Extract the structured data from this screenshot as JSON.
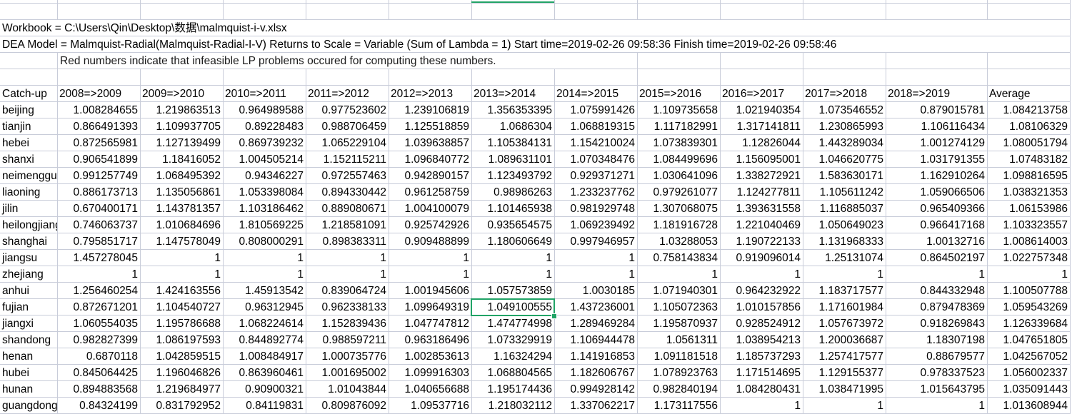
{
  "info": {
    "workbook": "Workbook = C:\\Users\\Qin\\Desktop\\数据\\malmquist-i-v.xlsx",
    "model": "DEA Model = Malmquist-Radial(Malmquist-Radial-I-V)  Returns to Scale = Variable (Sum of Lambda = 1)  Start time=2019-02-26  09:58:36   Finish time=2019-02-26  09:58:46",
    "note": "Red numbers indicate that infeasible LP problems occured for computing these numbers."
  },
  "table": {
    "headers": [
      "Catch-up",
      "2008=>2009",
      "2009=>2010",
      "2010=>2011",
      "2011=>2012",
      "2012=>2013",
      "2013=>2014",
      "2014=>2015",
      "2015=>2016",
      "2016=>2017",
      "2017=>2018",
      "2018=>2019",
      "Average"
    ],
    "rows": [
      [
        "beijing",
        "1.008284655",
        "1.219863513",
        "0.964989588",
        "0.977523602",
        "1.239106819",
        "1.356353395",
        "1.075991426",
        "1.109735658",
        "1.021940354",
        "1.073546552",
        "0.879015781",
        "1.084213758"
      ],
      [
        "tianjin",
        "0.866491393",
        "1.109937705",
        "0.89228483",
        "0.988706459",
        "1.125518859",
        "1.0686304",
        "1.068819315",
        "1.117182991",
        "1.317141811",
        "1.230865993",
        "1.106116434",
        "1.08106329"
      ],
      [
        "hebei",
        "0.872565981",
        "1.127139499",
        "0.869739232",
        "1.065229104",
        "1.039638857",
        "1.105384131",
        "1.154210024",
        "1.073839301",
        "1.12826044",
        "1.443289034",
        "1.001274129",
        "1.080051794"
      ],
      [
        "shanxi",
        "0.906541899",
        "1.18416052",
        "1.004505214",
        "1.152115211",
        "1.096840772",
        "1.089631101",
        "1.070348476",
        "1.084499696",
        "1.156095001",
        "1.046620775",
        "1.031791355",
        "1.07483182"
      ],
      [
        "neimenggu",
        "0.991257749",
        "1.068495392",
        "0.94346227",
        "0.972557463",
        "0.942890157",
        "1.123493792",
        "0.929371271",
        "1.030641096",
        "1.338272921",
        "1.583630171",
        "1.162910264",
        "1.098816595"
      ],
      [
        "liaoning",
        "0.886173713",
        "1.135056861",
        "1.053398084",
        "0.894330442",
        "0.961258759",
        "0.98986263",
        "1.233237762",
        "0.979261077",
        "1.124277811",
        "1.105611242",
        "1.059066506",
        "1.038321353"
      ],
      [
        "jilin",
        "0.670400171",
        "1.143781357",
        "1.103186462",
        "0.889080671",
        "1.004100079",
        "1.101465938",
        "0.981929748",
        "1.307068075",
        "1.393631558",
        "1.116885037",
        "0.965409366",
        "1.06153986"
      ],
      [
        "heilongjiang",
        "0.746063737",
        "1.010684696",
        "1.810569225",
        "1.218581091",
        "0.925742926",
        "0.935654575",
        "1.069239492",
        "1.181916728",
        "1.221040469",
        "1.050649023",
        "0.966417168",
        "1.103323557"
      ],
      [
        "shanghai",
        "0.795851717",
        "1.147578049",
        "0.808000291",
        "0.898383311",
        "0.909488899",
        "1.180606649",
        "0.997946957",
        "1.03288053",
        "1.190722133",
        "1.131968333",
        "1.00132716",
        "1.008614003"
      ],
      [
        "jiangsu",
        "1.457278045",
        "1",
        "1",
        "1",
        "1",
        "1",
        "1",
        "0.758143834",
        "0.919096014",
        "1.25131074",
        "0.864502197",
        "1.022757348"
      ],
      [
        "zhejiang",
        "1",
        "1",
        "1",
        "1",
        "1",
        "1",
        "1",
        "1",
        "1",
        "1",
        "1",
        "1"
      ],
      [
        "anhui",
        "1.256460254",
        "1.424163556",
        "1.45913542",
        "0.839064724",
        "1.001945606",
        "1.057573859",
        "1.0030185",
        "1.071940301",
        "0.964232922",
        "1.183717577",
        "0.844332948",
        "1.100507788"
      ],
      [
        "fujian",
        "0.872671201",
        "1.104540727",
        "0.96312945",
        "0.962338133",
        "1.099649319",
        "1.049100555",
        "1.437236001",
        "1.105072363",
        "1.010157856",
        "1.171601984",
        "0.879478369",
        "1.059543269"
      ],
      [
        "jiangxi",
        "1.060554035",
        "1.195786688",
        "1.068224614",
        "1.152839436",
        "1.047747812",
        "1.474774998",
        "1.289469284",
        "1.195870937",
        "0.928524912",
        "1.057673972",
        "0.918269843",
        "1.126339684"
      ],
      [
        "shandong",
        "0.982827399",
        "1.086197593",
        "0.844892774",
        "0.988597211",
        "0.963186496",
        "1.073329919",
        "1.106944478",
        "1.0561311",
        "1.038954213",
        "1.200036687",
        "1.18307198",
        "1.047651805"
      ],
      [
        "henan",
        "0.6870118",
        "1.042859515",
        "1.008484917",
        "1.000735776",
        "1.002853613",
        "1.16324294",
        "1.141916853",
        "1.091181518",
        "1.185737293",
        "1.257417577",
        "0.88679577",
        "1.042567052"
      ],
      [
        "hubei",
        "0.845064425",
        "1.196046826",
        "0.863960461",
        "1.001695002",
        "1.099916303",
        "1.068804565",
        "1.182606767",
        "1.078923763",
        "1.171514695",
        "1.129155377",
        "0.978337523",
        "1.056002337"
      ],
      [
        "hunan",
        "0.894883568",
        "1.219684977",
        "0.90900321",
        "1.01043844",
        "1.040656688",
        "1.195174436",
        "0.994928142",
        "0.982840194",
        "1.084280431",
        "1.038471995",
        "1.015643795",
        "1.035091443"
      ],
      [
        "guangdong",
        "0.84324199",
        "0.831792952",
        "0.84119831",
        "0.809876092",
        "1.09537716",
        "1.218032112",
        "1.337062217",
        "1.173117556",
        "1",
        "1",
        "1",
        "1.013608944"
      ]
    ]
  },
  "colors": {
    "grid": "#c8ccd9",
    "selection": "#21a366"
  }
}
